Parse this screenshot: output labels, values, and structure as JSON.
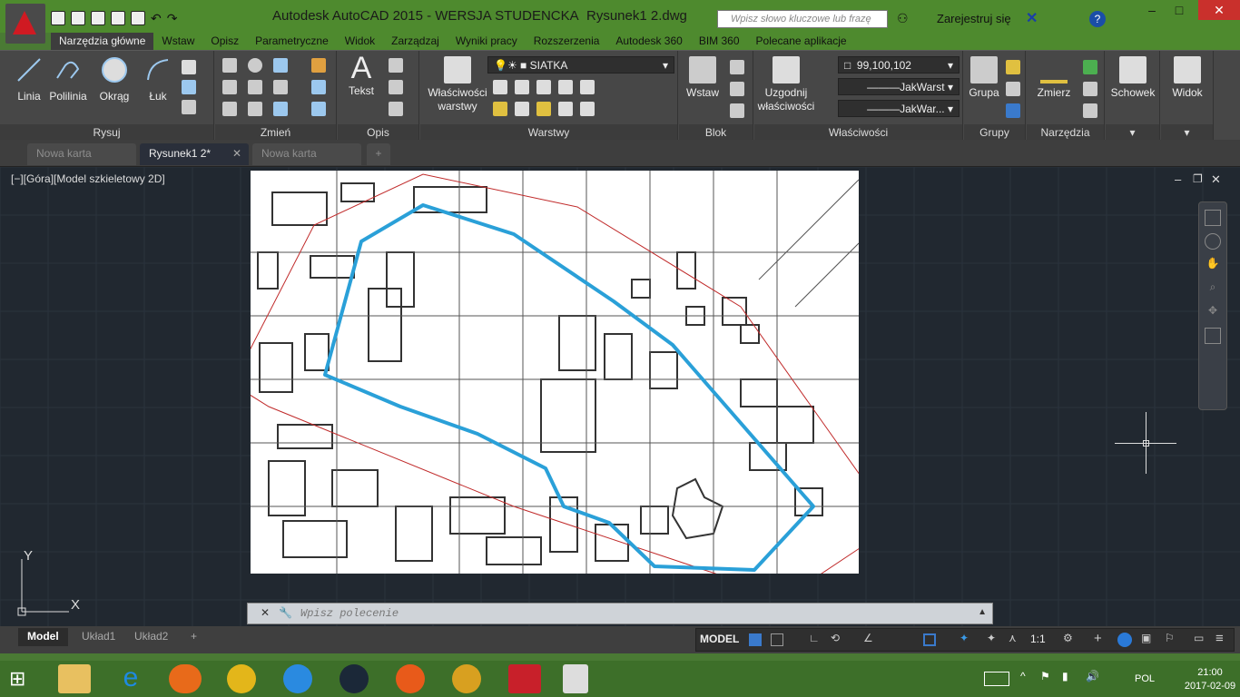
{
  "window": {
    "title": "Autodesk AutoCAD 2015 - WERSJA STUDENCKA",
    "document": "Rysunek1 2.dwg",
    "search_placeholder": "Wpisz słowo kluczowe lub frazę",
    "signin": "Zarejestruj się"
  },
  "ribbon_tabs": [
    "Narzędzia główne",
    "Wstaw",
    "Opisz",
    "Parametryczne",
    "Widok",
    "Zarządzaj",
    "Wyniki pracy",
    "Rozszerzenia",
    "Autodesk 360",
    "BIM 360",
    "Polecane aplikacje"
  ],
  "panels": {
    "rysuj": {
      "title": "Rysuj",
      "buttons": [
        "Linia",
        "Polilinia",
        "Okrąg",
        "Łuk"
      ]
    },
    "zmien": {
      "title": "Zmień"
    },
    "opis": {
      "title": "Opis",
      "button": "Tekst"
    },
    "warstwy": {
      "title": "Warstwy",
      "button1": "Właściwości",
      "button2": "warstwy",
      "layer": "SIATKA"
    },
    "blok": {
      "title": "Blok",
      "button": "Wstaw"
    },
    "wlasciwosci": {
      "title": "Właściwości",
      "button1": "Uzgodnij",
      "button2": "właściwości",
      "color": "99,100,102",
      "linetype": "JakWarst",
      "lineweight": "JakWar..."
    },
    "grupy": {
      "title": "Grupy",
      "button": "Grupa"
    },
    "narzedzia": {
      "title": "Narzędzia",
      "button": "Zmierz"
    },
    "schowek": {
      "title": "Schowek"
    },
    "widok": {
      "title": "Widok"
    }
  },
  "doc_tabs": [
    "Nowa karta",
    "Rysunek1 2*",
    "Nowa karta"
  ],
  "viewport": {
    "label": "[−][Góra][Model szkieletowy 2D]",
    "axis_y": "Y",
    "axis_x": "X"
  },
  "command": {
    "placeholder": "Wpisz polecenie"
  },
  "layout_tabs": [
    "Model",
    "Układ1",
    "Układ2"
  ],
  "status": {
    "model": "MODEL",
    "scale": "1:1"
  },
  "taskbar": {
    "lang": "POL",
    "time": "21:00",
    "date": "2017-02-09"
  },
  "colors": {
    "accent_green": "#4e8a2e",
    "boundary": "#2aa0d8",
    "redline": "#c02a2a"
  }
}
